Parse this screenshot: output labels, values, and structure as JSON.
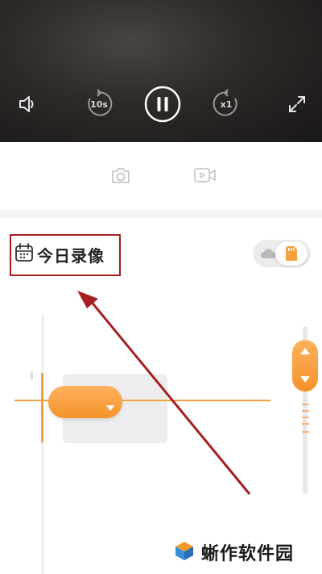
{
  "player": {
    "controls": [
      "volume-icon",
      "rewind-10s-icon",
      "pause-icon",
      "speed-x1-icon",
      "fullscreen-icon"
    ],
    "rewind_label": "10s",
    "speed_label": "x1"
  },
  "toolbar": {
    "items": [
      "camera-icon",
      "record-video-icon"
    ]
  },
  "date_filter": {
    "label": "今日录像",
    "icon": "calendar-icon"
  },
  "storage_toggle": {
    "options": [
      "cloud-icon",
      "sd-card-icon"
    ],
    "selected": "sd-card"
  },
  "watermark": {
    "text": "蜥作软件园"
  },
  "colors": {
    "accent": "#f5932b",
    "highlight_box": "#a51f22",
    "video_bg": "#2c2927"
  }
}
